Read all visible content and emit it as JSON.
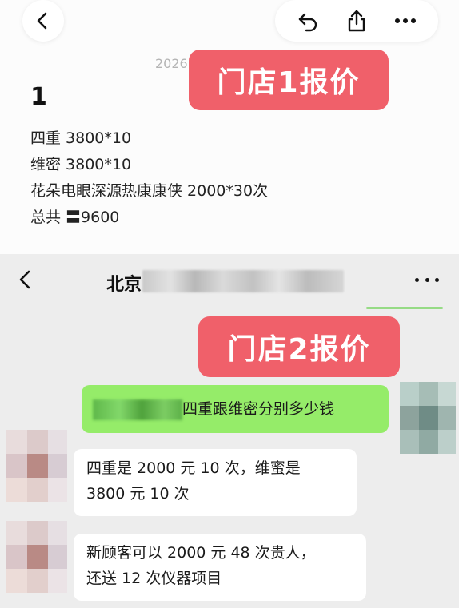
{
  "note": {
    "date_fragment": "2026",
    "title": "1",
    "lines": [
      "四重 3800*10",
      "维密 3800*10",
      "花朵电眼深源热康康侠 2000*30次",
      "总共 〓9600"
    ]
  },
  "labels": {
    "store1": "门店1报价",
    "store2": "门店2报价"
  },
  "chat": {
    "title_prefix": "北京",
    "sent_message": "四重跟维密分别多少钱",
    "received": [
      {
        "line1": "四重是 2000 元 10 次，维蜜是",
        "line2": "3800 元 10 次"
      },
      {
        "line1": "新顾客可以 2000 元 48 次贵人，",
        "line2": "还送 12 次仪器项目"
      }
    ]
  },
  "icons": [
    "back-icon",
    "reply-icon",
    "share-icon",
    "more-icon",
    "chat-back-icon",
    "chat-more-icon"
  ],
  "colors": {
    "label_badge": "#f0606a",
    "sent_bubble": "#95ec69",
    "chat_bg": "#ededed"
  }
}
